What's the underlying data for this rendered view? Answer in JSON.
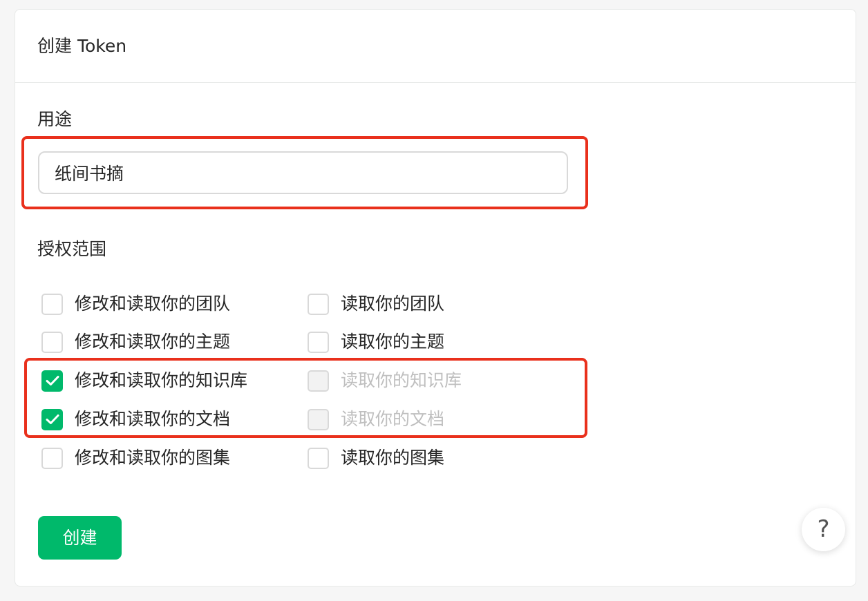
{
  "header": {
    "title": "创建 Token"
  },
  "purpose": {
    "label": "用途",
    "value": "纸间书摘"
  },
  "scope": {
    "label": "授权范围",
    "rows": [
      {
        "write": {
          "label": "修改和读取你的团队",
          "checked": false,
          "disabled": false
        },
        "read": {
          "label": "读取你的团队",
          "checked": false,
          "disabled": false
        }
      },
      {
        "write": {
          "label": "修改和读取你的主题",
          "checked": false,
          "disabled": false
        },
        "read": {
          "label": "读取你的主题",
          "checked": false,
          "disabled": false
        }
      },
      {
        "write": {
          "label": "修改和读取你的知识库",
          "checked": true,
          "disabled": false
        },
        "read": {
          "label": "读取你的知识库",
          "checked": true,
          "disabled": true
        }
      },
      {
        "write": {
          "label": "修改和读取你的文档",
          "checked": true,
          "disabled": false
        },
        "read": {
          "label": "读取你的文档",
          "checked": true,
          "disabled": true
        }
      },
      {
        "write": {
          "label": "修改和读取你的图集",
          "checked": false,
          "disabled": false
        },
        "read": {
          "label": "读取你的图集",
          "checked": false,
          "disabled": false
        }
      }
    ]
  },
  "actions": {
    "create_label": "创建",
    "help_label": "?"
  },
  "colors": {
    "primary": "#00b96b",
    "highlight": "#e9301c",
    "disabled_text": "#bfbfbf"
  },
  "icons": {
    "checkbox_mark": "check-icon",
    "help": "question-icon"
  }
}
